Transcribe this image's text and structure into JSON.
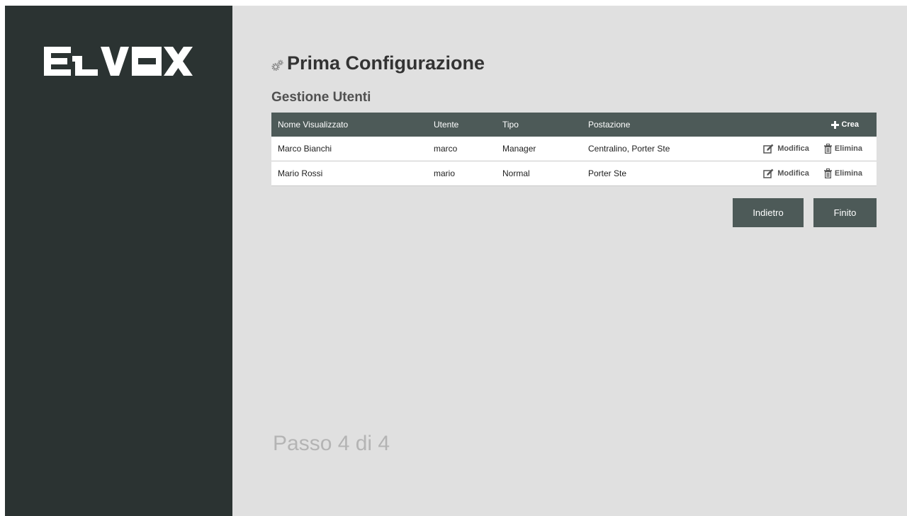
{
  "brand": {
    "logo_text": "ELVOX"
  },
  "page": {
    "title": "Prima Configurazione",
    "title_icon": "gears-icon"
  },
  "section": {
    "title": "Gestione Utenti"
  },
  "table": {
    "columns": {
      "name": "Nome Visualizzato",
      "user": "Utente",
      "type": "Tipo",
      "station": "Postazione"
    },
    "create_label": "Crea",
    "create_icon": "plus-icon",
    "edit_label": "Modifica",
    "edit_icon": "edit-icon",
    "delete_label": "Elimina",
    "delete_icon": "trash-icon",
    "rows": [
      {
        "name": "Marco Bianchi",
        "user": "marco",
        "type": "Manager",
        "station": "Centralino, Porter Ste"
      },
      {
        "name": "Mario Rossi",
        "user": "mario",
        "type": "Normal",
        "station": "Porter Ste"
      }
    ]
  },
  "navigation": {
    "back_label": "Indietro",
    "finish_label": "Finito"
  },
  "footer": {
    "step": "Passo 4 di 4"
  },
  "colors": {
    "sidebar": "#2b3332",
    "background": "#e0e0e0",
    "header": "#4d5a58",
    "button": "#4d5a58",
    "step_text": "#b4b4b4"
  }
}
